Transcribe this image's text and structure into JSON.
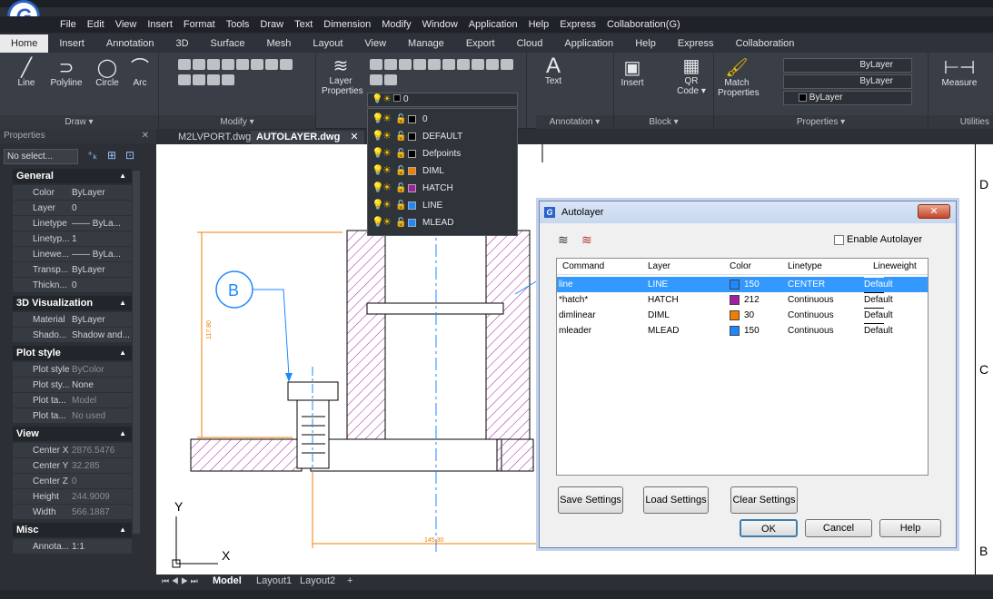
{
  "app": {
    "logo_letter": "G"
  },
  "menu": [
    "File",
    "Edit",
    "View",
    "Insert",
    "Format",
    "Tools",
    "Draw",
    "Text",
    "Dimension",
    "Modify",
    "Window",
    "Application",
    "Help",
    "Express",
    "Collaboration(G)"
  ],
  "ribbon_tabs": [
    "Home",
    "Insert",
    "Annotation",
    "3D",
    "Surface",
    "Mesh",
    "Layout",
    "View",
    "Manage",
    "Export",
    "Cloud",
    "Application",
    "Help",
    "Express",
    "Collaboration"
  ],
  "ribbon": {
    "draw": {
      "line": "Line",
      "polyline": "Polyline",
      "circle": "Circle",
      "arc": "Arc",
      "footer": "Draw ▾"
    },
    "modify": {
      "footer": "Modify ▾"
    },
    "layer": {
      "label1": "Layer",
      "label2": "Properties",
      "current": "0"
    },
    "annotation": {
      "text": "Text",
      "footer": "Annotation ▾"
    },
    "block": {
      "insert": "Insert",
      "qr1": "QR",
      "qr2": "Code ▾",
      "footer": "Block ▾"
    },
    "properties": {
      "match1": "Match",
      "match2": "Properties",
      "bylayer1": "ByLayer",
      "bylayer2": "ByLayer",
      "bylayer3": "ByLayer",
      "footer": "Properties ▾"
    },
    "utilities": {
      "measure": "Measure",
      "footer": "Utilities"
    }
  },
  "properties_panel": {
    "title": "Properties",
    "selection": "No select...",
    "sections": [
      {
        "name": "General",
        "rows": [
          [
            "Color",
            "ByLayer"
          ],
          [
            "Layer",
            "0"
          ],
          [
            "Linetype",
            "—— ByLa..."
          ],
          [
            "Linetyp...",
            "1"
          ],
          [
            "Linewe...",
            "—— ByLa..."
          ],
          [
            "Transp...",
            "ByLayer"
          ],
          [
            "Thickn...",
            "0"
          ]
        ]
      },
      {
        "name": "3D Visualization",
        "rows": [
          [
            "Material",
            "ByLayer"
          ],
          [
            "Shado...",
            "Shadow and..."
          ]
        ]
      },
      {
        "name": "Plot style",
        "rows": [
          [
            "Plot style",
            "ByColor"
          ],
          [
            "Plot sty...",
            "None"
          ],
          [
            "Plot ta...",
            "Model"
          ],
          [
            "Plot ta...",
            "No used"
          ]
        ]
      },
      {
        "name": "View",
        "rows": [
          [
            "Center X",
            "2876.5476"
          ],
          [
            "Center Y",
            "32.285"
          ],
          [
            "Center Z",
            "0"
          ],
          [
            "Height",
            "244.9009"
          ],
          [
            "Width",
            "566.1887"
          ]
        ]
      },
      {
        "name": "Misc",
        "rows": [
          [
            "Annota...",
            "1:1"
          ]
        ]
      }
    ]
  },
  "doc_tabs": [
    "M2LVPORT.dwg",
    "AUTOLAYER.dwg"
  ],
  "layout_tabs": [
    "Model",
    "Layout1",
    "Layout2",
    "+"
  ],
  "layer_dropdown": [
    {
      "name": "0",
      "color": "#000000"
    },
    {
      "name": "DEFAULT",
      "color": "#000000"
    },
    {
      "name": "Defpoints",
      "color": "#000000"
    },
    {
      "name": "DIML",
      "color": "#f07f00"
    },
    {
      "name": "HATCH",
      "color": "#a020a0"
    },
    {
      "name": "LINE",
      "color": "#1e88ff"
    },
    {
      "name": "MLEAD",
      "color": "#1e88ff"
    }
  ],
  "drawing": {
    "callout": "B",
    "dim_vertical": "117.80",
    "dim_horizontal": "145.30",
    "axis_x": "X",
    "axis_y": "Y",
    "right_labels": [
      "D",
      "C",
      "B"
    ]
  },
  "dialog": {
    "title": "Autolayer",
    "close": "✕",
    "enable_label": "Enable Autolayer",
    "columns": [
      "Command",
      "Layer",
      "Color",
      "Linetype",
      "Lineweight"
    ],
    "rows": [
      {
        "command": "line",
        "layer": "LINE",
        "color": "150",
        "color_hex": "#1e88ff",
        "linetype": "CENTER",
        "lineweight": "Default"
      },
      {
        "command": "*hatch*",
        "layer": "HATCH",
        "color": "212",
        "color_hex": "#a020a0",
        "linetype": "Continuous",
        "lineweight": "Default"
      },
      {
        "command": "dimlinear",
        "layer": "DIML",
        "color": "30",
        "color_hex": "#f07f00",
        "linetype": "Continuous",
        "lineweight": "Default"
      },
      {
        "command": "mleader",
        "layer": "MLEAD",
        "color": "150",
        "color_hex": "#1e88ff",
        "linetype": "Continuous",
        "lineweight": "Default"
      }
    ],
    "buttons": {
      "save": "Save Settings",
      "load": "Load Settings",
      "clear": "Clear Settings",
      "ok": "OK",
      "cancel": "Cancel",
      "help": "Help"
    }
  }
}
